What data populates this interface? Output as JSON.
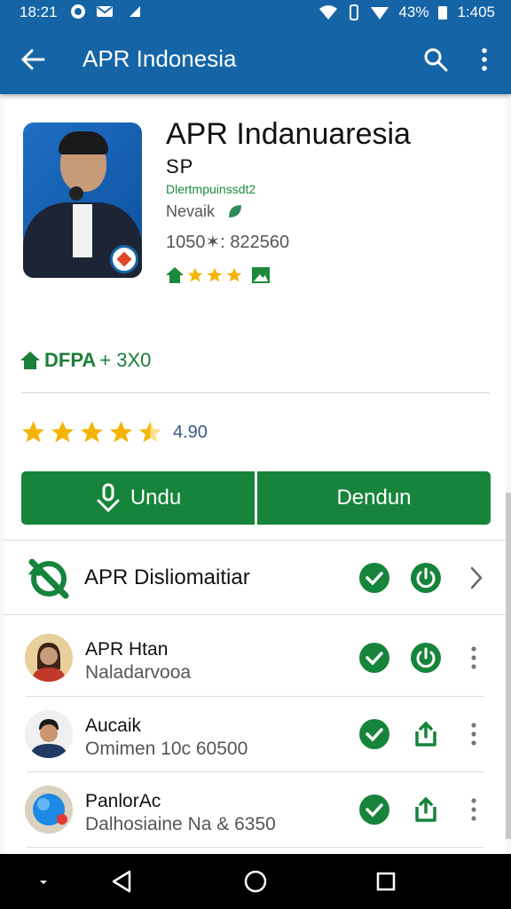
{
  "status_bar": {
    "time": "18:21",
    "battery": "43%",
    "clock_right": "1:405"
  },
  "app_bar": {
    "title": "APR Indonesia"
  },
  "app": {
    "name": "APR Indanuaresia",
    "subtitle": "SP",
    "developer": "Dlertmpuinssdt2",
    "category": "Nevaik",
    "size": "1050✶: 822560",
    "mini_rating_stars": 3
  },
  "stats": {
    "label": "DFPA",
    "value": "+ 3X0"
  },
  "rating": {
    "stars": 4.5,
    "value": "4.90"
  },
  "buttons": {
    "install": "Undu",
    "secondary": "Dendun"
  },
  "permission_row": {
    "label": "APR Disliomaitiar"
  },
  "list": [
    {
      "title": "APR Htan",
      "subtitle": "Naladarvooa",
      "action": "power"
    },
    {
      "title": "Aucaik",
      "subtitle": "Omimen 10c 60500",
      "action": "share"
    },
    {
      "title": "PanlorAc",
      "subtitle": "Dalhosiaine Na & 6350",
      "action": "share"
    }
  ],
  "colors": {
    "primary": "#1565a6",
    "accent": "#16843b",
    "star": "#f5b400"
  }
}
